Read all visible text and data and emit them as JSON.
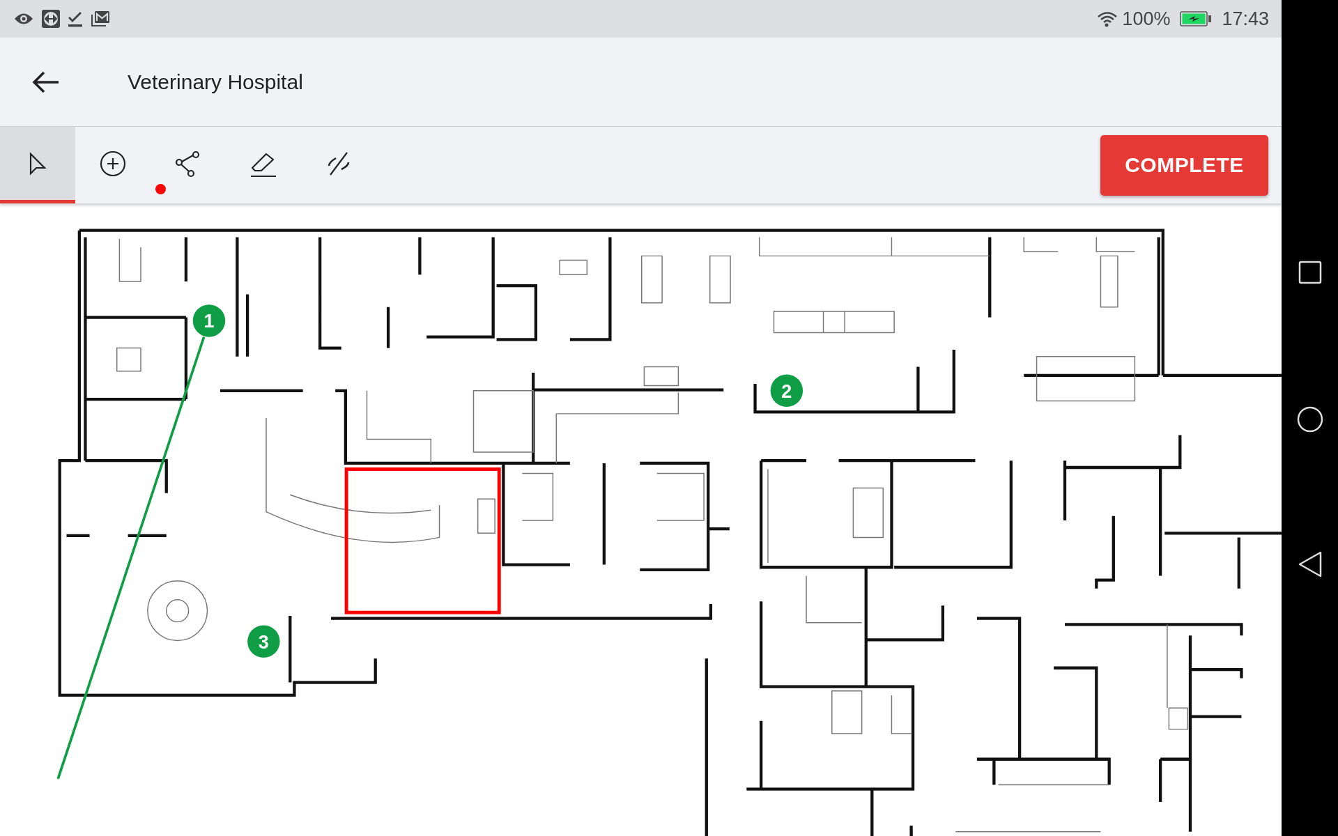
{
  "status_bar": {
    "battery": "100%",
    "time": "17:43"
  },
  "app_bar": {
    "title": "Veterinary Hospital"
  },
  "tools": [
    {
      "kind": "select",
      "selected": true
    },
    {
      "kind": "add",
      "selected": false
    },
    {
      "kind": "connect",
      "selected": false
    },
    {
      "kind": "erase",
      "selected": false
    },
    {
      "kind": "hide",
      "selected": false
    }
  ],
  "complete_button": {
    "label": "COMPLETE"
  },
  "map": {
    "markers": [
      {
        "label": "1"
      },
      {
        "label": "2"
      },
      {
        "label": "3"
      }
    ]
  }
}
